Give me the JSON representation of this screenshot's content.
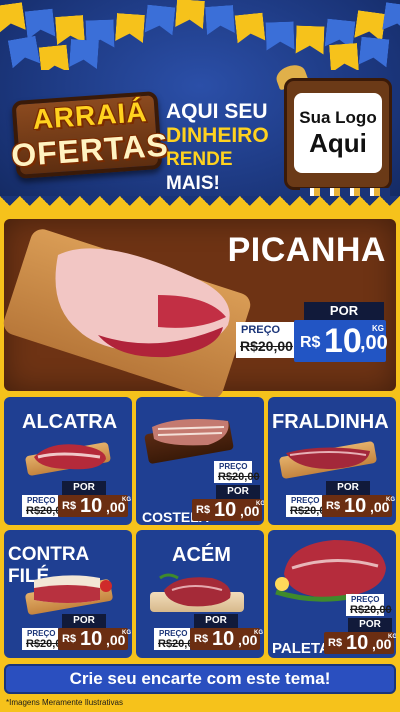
{
  "header": {
    "logo_line1": "ARRAIÁ",
    "logo_line2": "OFERTAS",
    "tagline_line1": "AQUI SEU",
    "tagline_line2": "DINHEIRO",
    "tagline_line3a": "RENDE",
    "tagline_line3b": "MAIS!",
    "store_logo_line1": "Sua Logo",
    "store_logo_line2": "Aqui"
  },
  "hero": {
    "title": "PICANHA",
    "por": "POR",
    "preco": "PREÇO",
    "old_price": "R$20,00",
    "currency": "R$",
    "price_int": "10",
    "price_cents": ",00",
    "unit": "KG"
  },
  "products": [
    {
      "name": "ALCATRA",
      "por": "POR",
      "preco": "PREÇO",
      "old_price": "R$20,00",
      "currency": "R$",
      "price_int": "10",
      "price_cents": ",00",
      "unit": "KG"
    },
    {
      "name": "COSTELA",
      "por": "POR",
      "preco": "PREÇO",
      "old_price": "R$20,00",
      "currency": "R$",
      "price_int": "10",
      "price_cents": ",00",
      "unit": "KG"
    },
    {
      "name": "FRALDINHA",
      "por": "POR",
      "preco": "PREÇO",
      "old_price": "R$20,00",
      "currency": "R$",
      "price_int": "10",
      "price_cents": ",00",
      "unit": "KG"
    },
    {
      "name": "CONTRA FILÉ",
      "por": "POR",
      "preco": "PREÇO",
      "old_price": "R$20,00",
      "currency": "R$",
      "price_int": "10",
      "price_cents": ",00",
      "unit": "KG"
    },
    {
      "name": "ACÉM",
      "por": "POR",
      "preco": "PREÇO",
      "old_price": "R$20,00",
      "currency": "R$",
      "price_int": "10",
      "price_cents": ",00",
      "unit": "KG"
    },
    {
      "name": "PALETA",
      "por": "POR",
      "preco": "PREÇO",
      "old_price": "R$20,00",
      "currency": "R$",
      "price_int": "10",
      "price_cents": ",00",
      "unit": "KG"
    }
  ],
  "cta_label": "Crie seu encarte com este tema!",
  "disclaimer": "*Imagens Meramente Ilustrativas",
  "colors": {
    "navy": "#1a3478",
    "yellow": "#f6c21b",
    "brown": "#6e3314",
    "price_blue": "#2255c4",
    "price_brown": "#6b2e12"
  }
}
